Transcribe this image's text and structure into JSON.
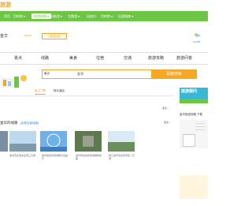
{
  "brand": {
    "logo_text": "旅游"
  },
  "nav": {
    "items": [
      {
        "label": "首页"
      },
      {
        "label": "目的地 ▾"
      },
      {
        "label": "旅游攻略 ▾"
      },
      {
        "label": "自助游 ▾"
      },
      {
        "label": "主题游 ▾"
      },
      {
        "label": "自由行"
      },
      {
        "label": "目的地 ▾"
      },
      {
        "label": "出游指南 ▾"
      }
    ],
    "selected_index": 2
  },
  "city": {
    "name": "金华",
    "sub": "Jinhua",
    "switch_label": "切换目的地"
  },
  "weather": {
    "label": "天气",
    "temp": "14/0℃"
  },
  "tabs": [
    "景点",
    "线路",
    "美食",
    "住宿",
    "交通",
    "旅游攻略",
    "旅游问答"
  ],
  "search": {
    "category": "景点",
    "query": "金华",
    "button": "百度搜索"
  },
  "main_tabs": [
    {
      "label": "景点门票",
      "active": true
    },
    {
      "label": "特价酒店",
      "active": false
    }
  ],
  "more_label": "更多 ›",
  "section": {
    "title": "金华的线路",
    "link": "[查看全部线路]"
  },
  "photos": [
    {
      "caption": "金华的线路介绍金华经典景点全景游"
    },
    {
      "caption": "金华双龙洞冰壶洞三日游"
    },
    {
      "caption": "金华横店影视城两日自由行"
    },
    {
      "caption": "金华周边城市旅游推荐线路"
    },
    {
      "caption": "浙江金华双龙风景区一日游"
    }
  ],
  "sidebar": {
    "ad_text": "旅游顾问",
    "title": "金华旅游攻略 下载"
  }
}
